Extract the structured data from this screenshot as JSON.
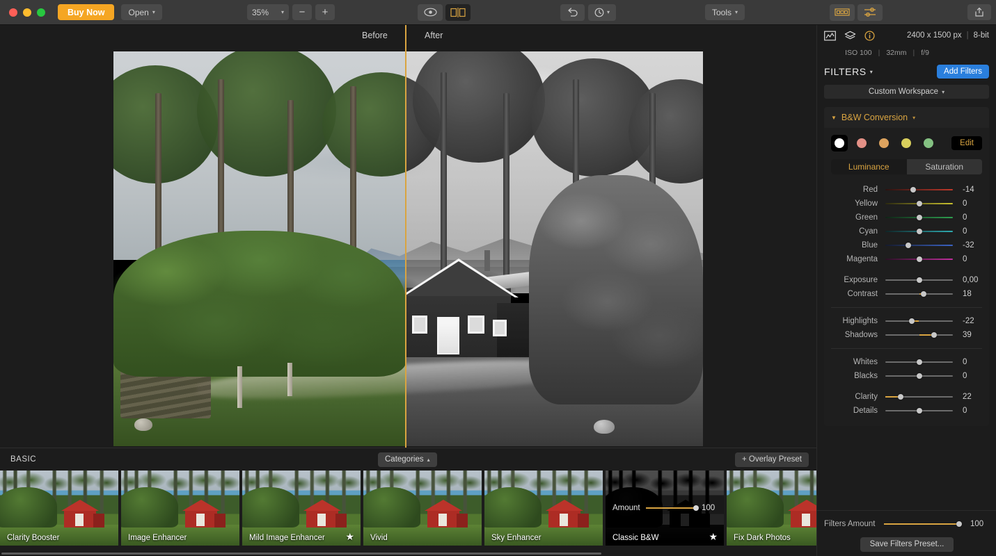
{
  "window": {
    "traffic_lights": [
      "close",
      "minimize",
      "maximize"
    ]
  },
  "toolbar": {
    "buy_now_label": "Buy Now",
    "open_label": "Open",
    "zoom_level": "35%",
    "zoom_out_label": "−",
    "zoom_in_label": "+",
    "eye_icon": "eye-icon",
    "compare_icon": "split-compare-icon",
    "undo_icon": "undo-icon",
    "history_icon": "history-clock-icon",
    "tools_label": "Tools",
    "filmstrip_icon": "filmstrip-icon",
    "adjust_icon": "adjustments-icon",
    "share_icon": "share-icon"
  },
  "canvas": {
    "before_label": "Before",
    "after_label": "After",
    "divider_color": "#d9a441"
  },
  "info": {
    "histogram_icon": "histogram-icon",
    "layers_icon": "layers-icon",
    "info_icon": "info-icon",
    "dimensions": "2400 x 1500 px",
    "bit_depth": "8-bit",
    "iso": "ISO 100",
    "focal": "32mm",
    "aperture": "f/9"
  },
  "filters_panel": {
    "title": "FILTERS",
    "add_filters_label": "Add Filters",
    "workspace_label": "Custom Workspace",
    "section_title": "B&W Conversion",
    "edit_label": "Edit",
    "swatches": [
      {
        "name": "white",
        "color": "#ffffff",
        "selected": true
      },
      {
        "name": "red",
        "color": "#e39086",
        "selected": false
      },
      {
        "name": "orange",
        "color": "#dda35e",
        "selected": false
      },
      {
        "name": "yellow",
        "color": "#d8cf5c",
        "selected": false
      },
      {
        "name": "green",
        "color": "#84c182",
        "selected": false
      }
    ],
    "tabs": [
      {
        "label": "Luminance",
        "active": true
      },
      {
        "label": "Saturation",
        "active": false
      }
    ],
    "color_sliders": [
      {
        "label": "Red",
        "value": "-14",
        "pos": 41,
        "color": "#c0392b"
      },
      {
        "label": "Yellow",
        "value": "0",
        "pos": 50,
        "color": "#c9c12e"
      },
      {
        "label": "Green",
        "value": "0",
        "pos": 50,
        "color": "#2e9e4f"
      },
      {
        "label": "Cyan",
        "value": "0",
        "pos": 50,
        "color": "#2eaab0"
      },
      {
        "label": "Blue",
        "value": "-32",
        "pos": 34,
        "color": "#3b63c4"
      },
      {
        "label": "Magenta",
        "value": "0",
        "pos": 50,
        "color": "#c12e9e"
      }
    ],
    "tone_sliders": [
      {
        "label": "Exposure",
        "value": "0,00",
        "pos": 50,
        "fill_from": 50
      },
      {
        "label": "Contrast",
        "value": "18",
        "pos": 57,
        "fill_from": 50
      },
      {
        "label": "Highlights",
        "value": "-22",
        "pos": 39,
        "fill_from": 50
      },
      {
        "label": "Shadows",
        "value": "39",
        "pos": 72,
        "fill_from": 50
      },
      {
        "label": "Whites",
        "value": "0",
        "pos": 50,
        "fill_from": 50
      },
      {
        "label": "Blacks",
        "value": "0",
        "pos": 50,
        "fill_from": 50
      },
      {
        "label": "Clarity",
        "value": "22",
        "pos": 23,
        "fill_from": 0
      },
      {
        "label": "Details",
        "value": "0",
        "pos": 50,
        "fill_from": 50
      }
    ],
    "filters_amount": {
      "label": "Filters Amount",
      "value": "100",
      "pos": 100
    },
    "save_preset_label": "Save Filters Preset..."
  },
  "presets_bar": {
    "group_label": "BASIC",
    "categories_label": "Categories",
    "overlay_preset_label": "+ Overlay Preset",
    "items": [
      {
        "name": "Clarity Booster",
        "starred": false,
        "selected": false,
        "bw": false
      },
      {
        "name": "Image Enhancer",
        "starred": false,
        "selected": false,
        "bw": false
      },
      {
        "name": "Mild Image Enhancer",
        "starred": true,
        "selected": false,
        "bw": false
      },
      {
        "name": "Vivid",
        "starred": false,
        "selected": false,
        "bw": false
      },
      {
        "name": "Sky Enhancer",
        "starred": false,
        "selected": false,
        "bw": false
      },
      {
        "name": "Classic B&W",
        "starred": true,
        "selected": true,
        "bw": true,
        "amount_label": "Amount",
        "amount_value": "100"
      },
      {
        "name": "Fix Dark Photos",
        "starred": false,
        "selected": false,
        "bw": false
      }
    ]
  }
}
